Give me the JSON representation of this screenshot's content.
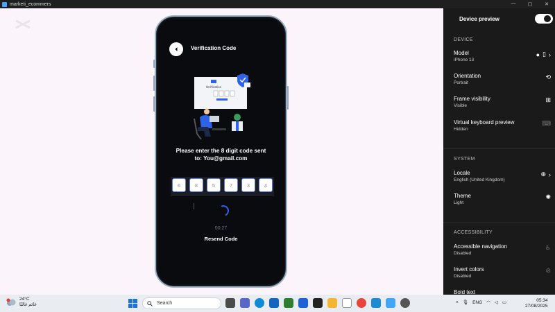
{
  "window": {
    "title": "marketi_ecommers"
  },
  "phone": {
    "screen_title": "Verification Code",
    "prompt_line1": "Please enter the 8 digit code sent",
    "prompt_line2": "to: You@gmail.com",
    "code_digits": [
      "6",
      "8",
      "5",
      "7",
      "3",
      "4"
    ],
    "timer": "00:27",
    "resend_label": "Resend Code",
    "illustration_card_title": "Verification"
  },
  "panel": {
    "header": "Device preview",
    "preview_enabled": true,
    "sections": {
      "device": "DEVICE",
      "system": "SYSTEM",
      "accessibility": "ACCESSIBILITY"
    },
    "settings": {
      "model": {
        "label": "Model",
        "value": "iPhone 13"
      },
      "orientation": {
        "label": "Orientation",
        "value": "Portrait"
      },
      "frame": {
        "label": "Frame visibility",
        "value": "Visible"
      },
      "keyboard": {
        "label": "Virtual keyboard preview",
        "value": "Hidden"
      },
      "locale": {
        "label": "Locale",
        "value": "English (United Kingdom)"
      },
      "theme": {
        "label": "Theme",
        "value": "Light"
      },
      "accessible_nav": {
        "label": "Accessible navigation",
        "value": "Disabled"
      },
      "invert": {
        "label": "Invert colors",
        "value": "Disabled"
      },
      "bold": {
        "label": "Bold text",
        "value": ""
      }
    }
  },
  "taskbar": {
    "weather_temp": "24°C",
    "weather_desc": "غائم غالبًا",
    "search_label": "Search",
    "language": "ENG",
    "time": "05:34",
    "date": "27/08/2025"
  },
  "colors": {
    "accent": "#2e63e8",
    "canvas_bg": "#fbf5fb",
    "panel_bg": "#1a1a1a"
  }
}
